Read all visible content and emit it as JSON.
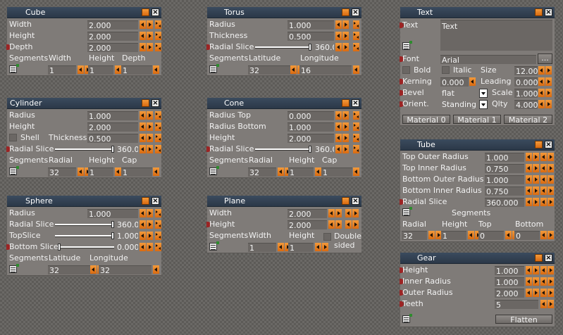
{
  "cube": {
    "title": "Cube",
    "width_label": "Width",
    "width": "2.000",
    "height_label": "Height",
    "height": "2.000",
    "depth_label": "Depth",
    "depth": "2.000",
    "segments_label": "Segments",
    "col_width": "Width",
    "col_height": "Height",
    "col_depth": "Depth",
    "seg_width": "1",
    "seg_height": "1",
    "seg_depth": "1"
  },
  "torus": {
    "title": "Torus",
    "radius_label": "Radius",
    "radius": "1.000",
    "thickness_label": "Thickness",
    "thickness": "0.500",
    "radial_slice_label": "Radial Slice",
    "radial_slice": "360.000",
    "radial_slice_fraction": 1.0,
    "segments_label": "Segments",
    "col_latitude": "Latitude",
    "col_longitude": "Longitude",
    "latitude": "32",
    "longitude": "16"
  },
  "text": {
    "title": "Text",
    "text_label": "Text",
    "text_value": "Text",
    "font_label": "Font",
    "font_value": "Arial",
    "browse_label": "...",
    "bold_label": "Bold",
    "italic_label": "Italic",
    "size_label": "Size",
    "size": "12.000",
    "kerning_label": "Kerning",
    "kerning": "0.000",
    "leading_label": "Leading",
    "leading": "0.000",
    "bevel_label": "Bevel",
    "bevel": "flat",
    "scale_label": "Scale",
    "scale": "1.000",
    "orient_label": "Orient.",
    "orient": "Standing",
    "qlty_label": "Qlty",
    "qlty": "4.000",
    "material0": "Material 0",
    "material1": "Material 1",
    "material2": "Material 2"
  },
  "cylinder": {
    "title": "Cylinder",
    "radius_label": "Radius",
    "radius": "1.000",
    "height_label": "Height",
    "height": "2.000",
    "shell_label": "Shell",
    "thickness_label": "Thickness",
    "thickness": "0.500",
    "radial_slice_label": "Radial Slice",
    "radial_slice": "360.000",
    "radial_slice_fraction": 1.0,
    "segments_label": "Segments",
    "col_radial": "Radial",
    "col_height": "Height",
    "col_cap": "Cap",
    "seg_radial": "32",
    "seg_height": "1",
    "seg_cap": "1"
  },
  "cone": {
    "title": "Cone",
    "radius_top_label": "Radius Top",
    "radius_top": "0.000",
    "radius_bottom_label": "Radius Bottom",
    "radius_bottom": "1.000",
    "height_label": "Height",
    "height": "2.000",
    "radial_slice_label": "Radial Slice",
    "radial_slice": "360.000",
    "radial_slice_fraction": 1.0,
    "segments_label": "Segments",
    "col_radial": "Radial",
    "col_height": "Height",
    "col_cap": "Cap",
    "seg_radial": "32",
    "seg_height": "1",
    "seg_cap": "1"
  },
  "tube": {
    "title": "Tube",
    "top_outer_label": "Top Outer Radius",
    "top_outer": "1.000",
    "top_inner_label": "Top Inner Radius",
    "top_inner": "0.750",
    "bottom_outer_label": "Bottom Outer Radius",
    "bottom_outer": "1.000",
    "bottom_inner_label": "Bottom Inner Radius",
    "bottom_inner": "0.750",
    "radial_slice_label": "Radial Slice",
    "radial_slice": "360.000",
    "segments_label": "Segments",
    "col_radial": "Radial",
    "col_height": "Height",
    "col_top": "Top",
    "col_bottom": "Bottom",
    "seg_radial": "32",
    "seg_height": "1",
    "seg_top": "0",
    "seg_bottom": "0"
  },
  "sphere": {
    "title": "Sphere",
    "radius_label": "Radius",
    "radius": "1.000",
    "radial_slice_label": "Radial Slice",
    "radial_slice": "360.000",
    "radial_slice_fraction": 1.0,
    "top_slice_label": "TopSlice",
    "top_slice": "1.000",
    "top_slice_fraction": 1.0,
    "bottom_slice_label": "Bottom Slice",
    "bottom_slice": "0.000",
    "bottom_slice_fraction": 0.0,
    "segments_label": "Segments",
    "col_latitude": "Latitude",
    "col_longitude": "Longitude",
    "latitude": "32",
    "longitude": "32"
  },
  "plane": {
    "title": "Plane",
    "width_label": "Width",
    "width": "2.000",
    "height_label": "Height",
    "height": "2.000",
    "segments_label": "Segments",
    "col_width": "Width",
    "col_height": "Height",
    "seg_width": "1",
    "seg_height": "1",
    "double_sided_label": "Double sided"
  },
  "gear": {
    "title": "Gear",
    "height_label": "Height",
    "height": "1.000",
    "inner_label": "Inner  Radius",
    "inner": "1.000",
    "outer_label": "Outer  Radius",
    "outer": "2.000",
    "teeth_label": "Teeth",
    "teeth": "5",
    "flatten_label": "Flatten"
  },
  "colors": {
    "titlebar": "#34445a",
    "panel": "#7f7b78",
    "field": "#6b6764",
    "accent": "#e57f20",
    "port": "#9b2424"
  },
  "icons": [
    "close-icon",
    "menu-icon",
    "spin-arrows-icon",
    "connector-port-icon",
    "dropdown-arrow-icon"
  ]
}
